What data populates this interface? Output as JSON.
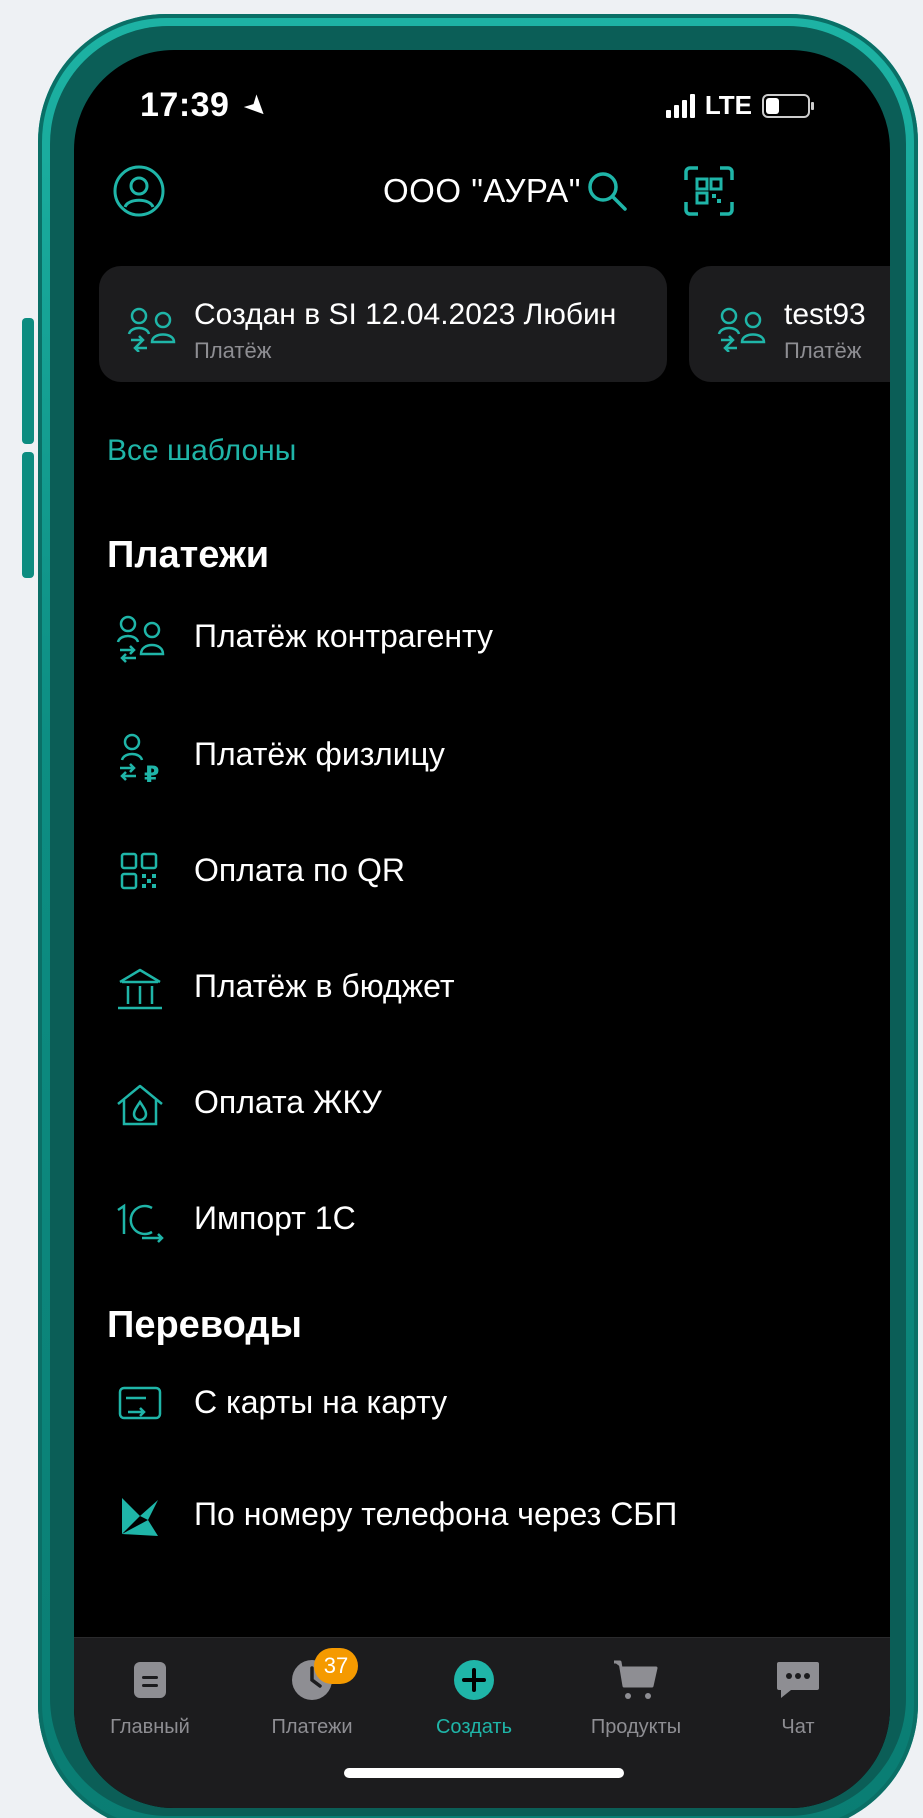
{
  "status_bar": {
    "time": "17:39",
    "network": "LTE",
    "battery_level": 0.35
  },
  "header": {
    "title": "ООО \"АУРА\""
  },
  "templates": {
    "cards": [
      {
        "title": "Создан в SI 12.04.2023 Любин",
        "subtitle": "Платёж"
      },
      {
        "title": "test93",
        "subtitle": "Платёж"
      }
    ],
    "all_label": "Все шаблоны"
  },
  "payments": {
    "title": "Платежи",
    "items": [
      {
        "label": "Платёж контрагенту",
        "icon": "counterparty-payment-icon"
      },
      {
        "label": "Платёж физлицу",
        "icon": "individual-payment-icon"
      },
      {
        "label": "Оплата по QR",
        "icon": "qr-code-icon"
      },
      {
        "label": "Платёж в бюджет",
        "icon": "budget-building-icon"
      },
      {
        "label": "Оплата ЖКУ",
        "icon": "house-utilities-icon"
      },
      {
        "label": "Импорт 1С",
        "icon": "import-1c-icon"
      }
    ]
  },
  "transfers": {
    "title": "Переводы",
    "items": [
      {
        "label": "С карты на карту",
        "icon": "card-transfer-icon"
      },
      {
        "label": "По номеру телефона через СБП",
        "icon": "sbp-icon"
      }
    ]
  },
  "tabbar": {
    "items": [
      {
        "label": "Главный",
        "icon": "document-icon"
      },
      {
        "label": "Платежи",
        "icon": "clock-icon",
        "badge": "37"
      },
      {
        "label": "Создать",
        "icon": "plus-circle-icon",
        "active": true
      },
      {
        "label": "Продукты",
        "icon": "cart-icon"
      },
      {
        "label": "Чат",
        "icon": "chat-icon"
      }
    ]
  },
  "colors": {
    "accent": "#1fb5a8",
    "badge": "#f59a00",
    "card": "#1c1c1e",
    "frame": "#0d8e83"
  }
}
